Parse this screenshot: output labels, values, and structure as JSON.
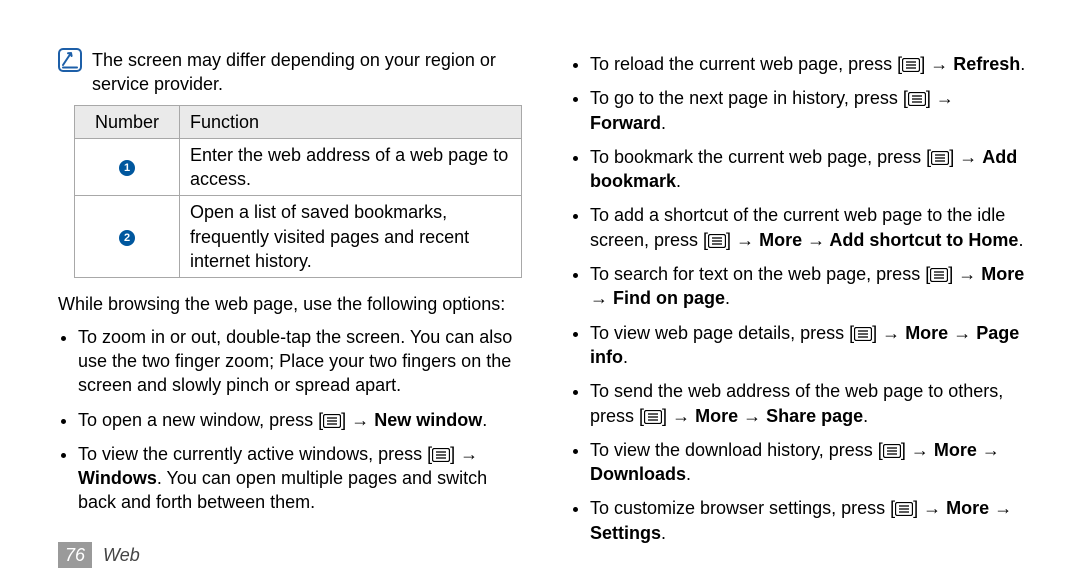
{
  "note": {
    "text": "The screen may differ depending on your region or service provider."
  },
  "table": {
    "headers": {
      "number": "Number",
      "function": "Function"
    },
    "rows": [
      {
        "num": "1",
        "func": "Enter the web address of a web page to access."
      },
      {
        "num": "2",
        "func": "Open a list of saved bookmarks, frequently visited pages and recent internet history."
      }
    ]
  },
  "intro": "While browsing the web page, use the following options:",
  "left_bullets": {
    "b1": {
      "text": "To zoom in or out, double-tap the screen. You can also use the two finger zoom; Place your two fingers on the screen and slowly pinch or spread apart."
    },
    "b2": {
      "pre": "To open a new window, press [",
      "arrow": "→",
      "bold": "New window",
      "post": "."
    },
    "b3": {
      "pre": "To view the currently active windows, press [",
      "arrow": "→",
      "bold": "Windows",
      "tail": ". You can open multiple pages and switch back and forth between them."
    }
  },
  "right_bullets": {
    "r1": {
      "pre": "To reload the current web page, press [",
      "arrow": "→",
      "bold": "Refresh",
      "post": "."
    },
    "r2": {
      "pre": "To go to the next page in history, press [",
      "arrow": "→",
      "bold": "Forward",
      "post": "."
    },
    "r3": {
      "pre": "To bookmark the current web page, press [",
      "arrow": "→",
      "bold": "Add bookmark",
      "post": "."
    },
    "r4": {
      "pre": "To add a shortcut of the current web page to the idle screen, press [",
      "arrow": "→",
      "bold": "More → Add shortcut to Home",
      "post": "."
    },
    "r5": {
      "pre": "To search for text on the web page, press [",
      "arrow": "→",
      "bold1": "More",
      "arrow2": "→",
      "bold2": "Find on page",
      "post": "."
    },
    "r6": {
      "pre": "To view web page details, press [",
      "arrow": "→",
      "bold1": "More",
      "arrow2": "→",
      "bold2": "Page info",
      "post": "."
    },
    "r7": {
      "pre": "To send the web address of the web page to others, press [",
      "arrow": "→",
      "bold": "More → Share page",
      "post": "."
    },
    "r8": {
      "pre": "To view the download history, press [",
      "arrow": "→",
      "bold1": "More",
      "arrow2": "→",
      "bold2": "Downloads",
      "post": "."
    },
    "r9": {
      "pre": "To customize browser settings, press [",
      "arrow": "→",
      "bold1": "More",
      "arrow2": "→",
      "bold2": "Settings",
      "post": "."
    }
  },
  "footer": {
    "page": "76",
    "section": "Web"
  },
  "bracket_close": "]"
}
